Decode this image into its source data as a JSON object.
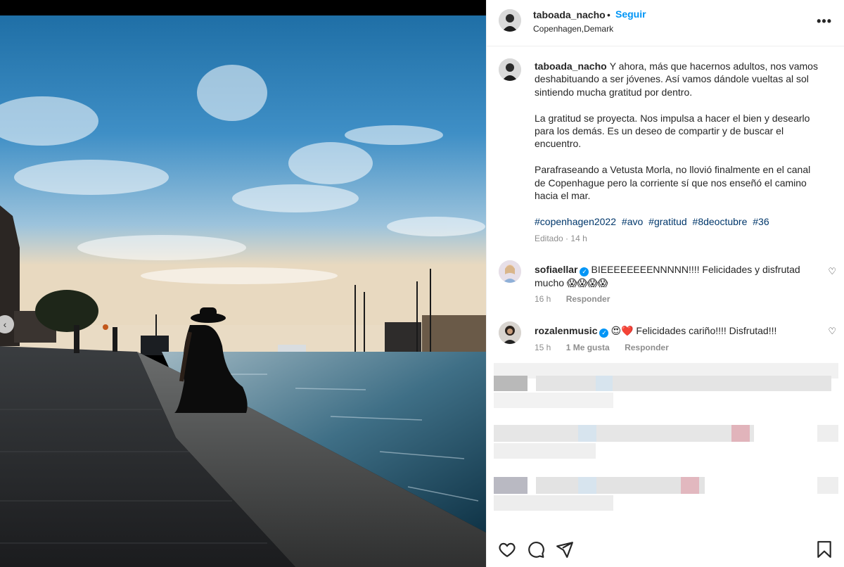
{
  "post": {
    "username": "taboada_nacho",
    "dot": "•",
    "follow_label": "Seguir",
    "location": "Copenhagen,Demark",
    "more_label": "•••"
  },
  "caption": {
    "username": "taboada_nacho",
    "p1": "Y ahora, más que hacernos adultos, nos vamos deshabituando a ser jóvenes. Así vamos dándole vueltas al sol sintiendo mucha gratitud por dentro.",
    "p2": "La gratitud se proyecta. Nos impulsa a hacer el bien y desearlo para los demás. Es un deseo de compartir y de buscar el encuentro.",
    "p3": "Parafraseando a Vetusta Morla, no llovió finalmente en el canal de Copenhague pero la corriente sí que nos enseñó el camino hacia el mar.",
    "hashtags": [
      "#copenhagen2022",
      "#avo",
      "#gratitud",
      "#8deoctubre",
      "#36"
    ],
    "edited": "Editado",
    "meta_dot": "·",
    "time": "14 h"
  },
  "comments": [
    {
      "username": "sofiaellar",
      "verified": "✓",
      "text": "BIEEEEEEEENNNNN!!!! Felicidades y disfrutad mucho 😱😱😱😱",
      "time": "16 h",
      "likes": "",
      "reply": "Responder"
    },
    {
      "username": "rozalenmusic",
      "verified": "✓",
      "text": "😍❤️ Felicidades cariño!!!! Disfrutad!!!",
      "time": "15 h",
      "likes": "1 Me gusta",
      "reply": "Responder"
    }
  ],
  "icons": {
    "like": "heart-icon",
    "comment": "comment-icon",
    "share": "share-icon",
    "save": "bookmark-icon"
  },
  "colors": {
    "link": "#0095f6",
    "hashtag": "#00376b",
    "muted": "#8e8e8e",
    "text": "#262626"
  }
}
